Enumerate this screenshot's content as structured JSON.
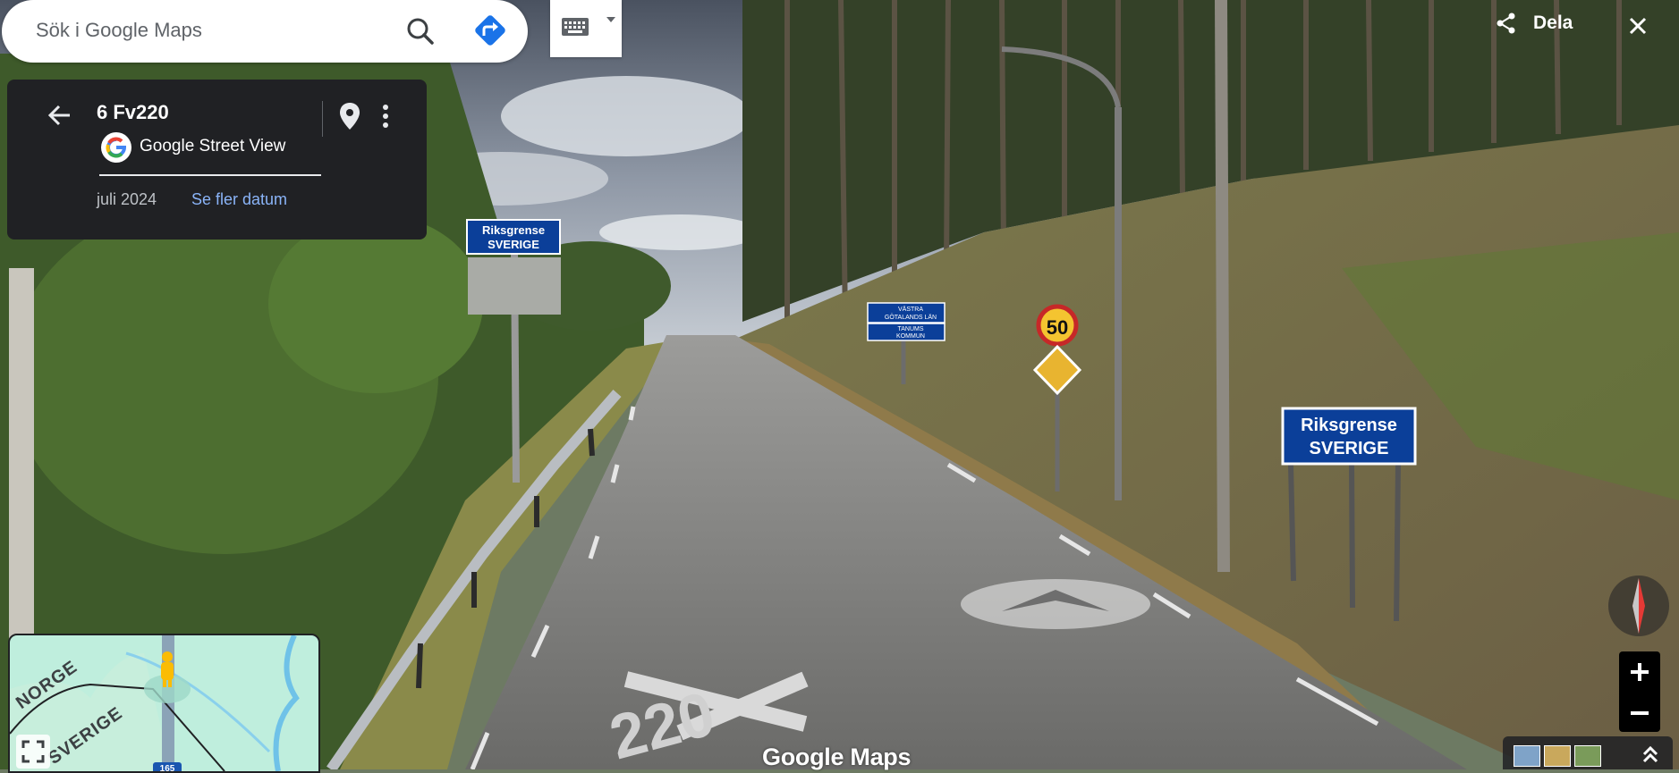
{
  "search": {
    "placeholder": "Sök i Google Maps"
  },
  "info_card": {
    "title": "6 Fv220",
    "provider": "Google Street View",
    "date": "juli 2024",
    "more_dates": "Se fler datum"
  },
  "top_right": {
    "share_label": "Dela"
  },
  "minimap": {
    "label_norway": "NORGE",
    "label_sweden": "SVERIGE",
    "road_shield": "165"
  },
  "scene": {
    "left_sign_line1": "Riksgrense",
    "left_sign_line2": "SVERIGE",
    "right_sign_line1": "Riksgrense",
    "right_sign_line2": "SVERIGE",
    "speed_limit": "50",
    "county_sign_line1": "VÄSTRA",
    "county_sign_line2": "GÖTALANDS LÄN",
    "municipality_sign_line1": "TANUMS",
    "municipality_sign_line2": "KOMMUN",
    "road_marking": "220"
  },
  "footer": {
    "watermark": "Google Maps"
  },
  "colors": {
    "accent_blue": "#1a73e8",
    "card_bg": "#202124",
    "link_blue": "#8ab4f8",
    "sign_blue": "#0b3f99"
  }
}
